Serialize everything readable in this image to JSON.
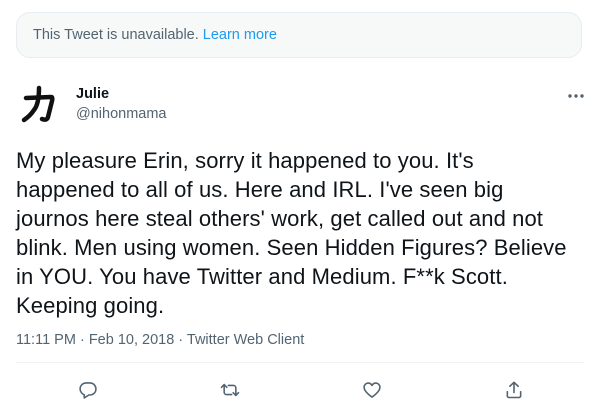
{
  "notice": {
    "text": "This Tweet is unavailable.",
    "link_label": "Learn more"
  },
  "author": {
    "display_name": "Julie",
    "handle": "@nihonmama",
    "avatar_glyph": "力",
    "avatar_icon": "kanji-avatar-icon"
  },
  "tweet": {
    "text": "My pleasure Erin, sorry it happened to you. It's\nhappened to all of us. Here and IRL. I've seen big\njournos here steal others' work, get called out and not\nblink. Men using women. Seen Hidden Figures? Believe\nin YOU. You have Twitter and Medium. F**k Scott.\nKeeping going."
  },
  "meta": {
    "time": "11:11 PM",
    "separator1": " · ",
    "date": "Feb 10, 2018",
    "separator2": " · ",
    "client": "Twitter Web Client"
  },
  "actions": [
    {
      "icon": "reply-icon"
    },
    {
      "icon": "retweet-icon"
    },
    {
      "icon": "like-icon"
    },
    {
      "icon": "share-icon"
    }
  ],
  "colors": {
    "accent": "#1d9bf0",
    "text": "#0f1419",
    "muted": "#536471",
    "notice_bg": "#f7f9f9"
  }
}
